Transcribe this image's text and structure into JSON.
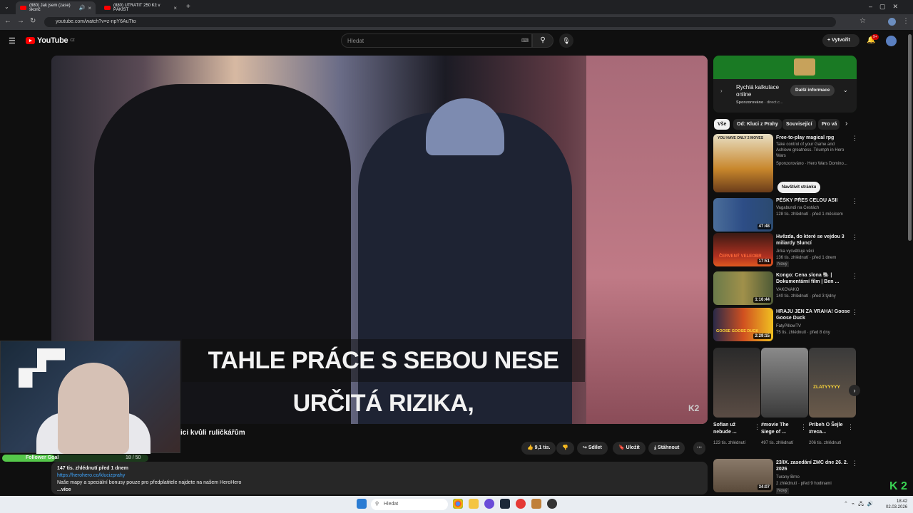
{
  "browser": {
    "tabs": [
      {
        "title": "(880) Jak jsem (zase) skonč"
      },
      {
        "title": "(880) UTRATIT 250 Kč v PÁKIST"
      }
    ],
    "new_tab": "+",
    "url": "youtube.com/watch?v=z-npY6AuTto"
  },
  "header": {
    "logo_text": "YouTube",
    "region": "CZ",
    "search_placeholder": "Hledat",
    "create_label": "Vytvořit",
    "notifications_badge": "9+"
  },
  "video": {
    "subtitle": "TAHLE PRÁCE S SEBOU NESE URČITÁ RIZIKA,",
    "watermark": "K2",
    "title_visible": "ici kvůli ruličkářům",
    "likes": "9,1 tis.",
    "share": "Sdílet",
    "save": "Uložit",
    "download": "Stáhnout",
    "views_date": "147 tis. zhlédnutí  před 1 dnem",
    "desc_link": "https://herohero.co/klucizprahy",
    "desc_line": "Naše mapy a speciální bonusy pouze pro předplatitele najdete na našem HeroHero",
    "desc_more": "...více"
  },
  "overlay": {
    "follower_label": "Follower Goal",
    "follower_count": "18 / 50",
    "follower_progress": 0.36,
    "brand": "K2"
  },
  "ad": {
    "title": "Rychlá kalkulace online",
    "sponsored": "Sponzorováno",
    "source": "direct.c...",
    "cta": "Další informace"
  },
  "chips": [
    "Vše",
    "Od: Kluci z Prahy",
    "Související",
    "Pro vá"
  ],
  "recommendations": [
    {
      "title": "Free-to-play magical rpg",
      "meta1": "Take control of your Game and Achieve greatness. Triumph in Hero Wars",
      "meta2": "Sponzorováno · Hero Wars Domino...",
      "extra": "Navštívit stránku",
      "thumb_text": "YOU HAVE ONLY 2 MOVES"
    },
    {
      "title": "PĚŠKY PŘES CELOU ASII",
      "meta1": "Vagabundi na Cestách",
      "meta2": "128 tis. zhlédnutí · před 1 měsícem",
      "duration": "47:48"
    },
    {
      "title": "Hvězda, do které se vejdou 3 miliardy Sluncí",
      "meta1": "Jirka vysvětluje věci",
      "meta2": "136 tis. zhlédnutí · před 1 dnem",
      "badge": "Nový",
      "duration": "17:51",
      "thumb_text": "ČERVENÝ VELEOBR"
    },
    {
      "title": "Kongo: Cena slona 🐘 | Dokumentární film | Ben ...",
      "meta1": "VAKOVAKO",
      "meta2": "140 tis. zhlédnutí · před 3 týdny",
      "duration": "1:16:44"
    },
    {
      "title": "HRAJU JEN ZA VRAHA! Goose Goose Duck",
      "meta1": "FatyPillowTV",
      "meta2": "75 tis. zhlédnutí · před 8 dny",
      "duration": "2:29:15",
      "thumb_text": "GOOSE GOOSE DUCK"
    }
  ],
  "shorts": [
    {
      "title": "Sofian už nebude ...",
      "meta": "123 tis. zhlédnutí"
    },
    {
      "title": "#movie The Siege of ...",
      "meta": "497 tis. zhlédnutí"
    },
    {
      "title": "Pribeh O Šejle #reca...",
      "meta": "206 tis. zhlédnutí",
      "thumb_text": "ZLATYYYYY"
    }
  ],
  "last_rec": {
    "title": "23/IX. zasedání ZMČ dne 26. 2. 2026",
    "meta1": "Turany Brno",
    "meta2": "2 zhlédnutí · před 9 hodinami",
    "badge": "Nový",
    "duration": "34:07"
  },
  "taskbar": {
    "search": "Hledat",
    "time": "18:42",
    "date": "02.03.2026"
  },
  "colors": {
    "accent": "#ff0000",
    "follower": "#55c84a",
    "link": "#3ea6ff",
    "ad_green": "#1a7a24"
  }
}
